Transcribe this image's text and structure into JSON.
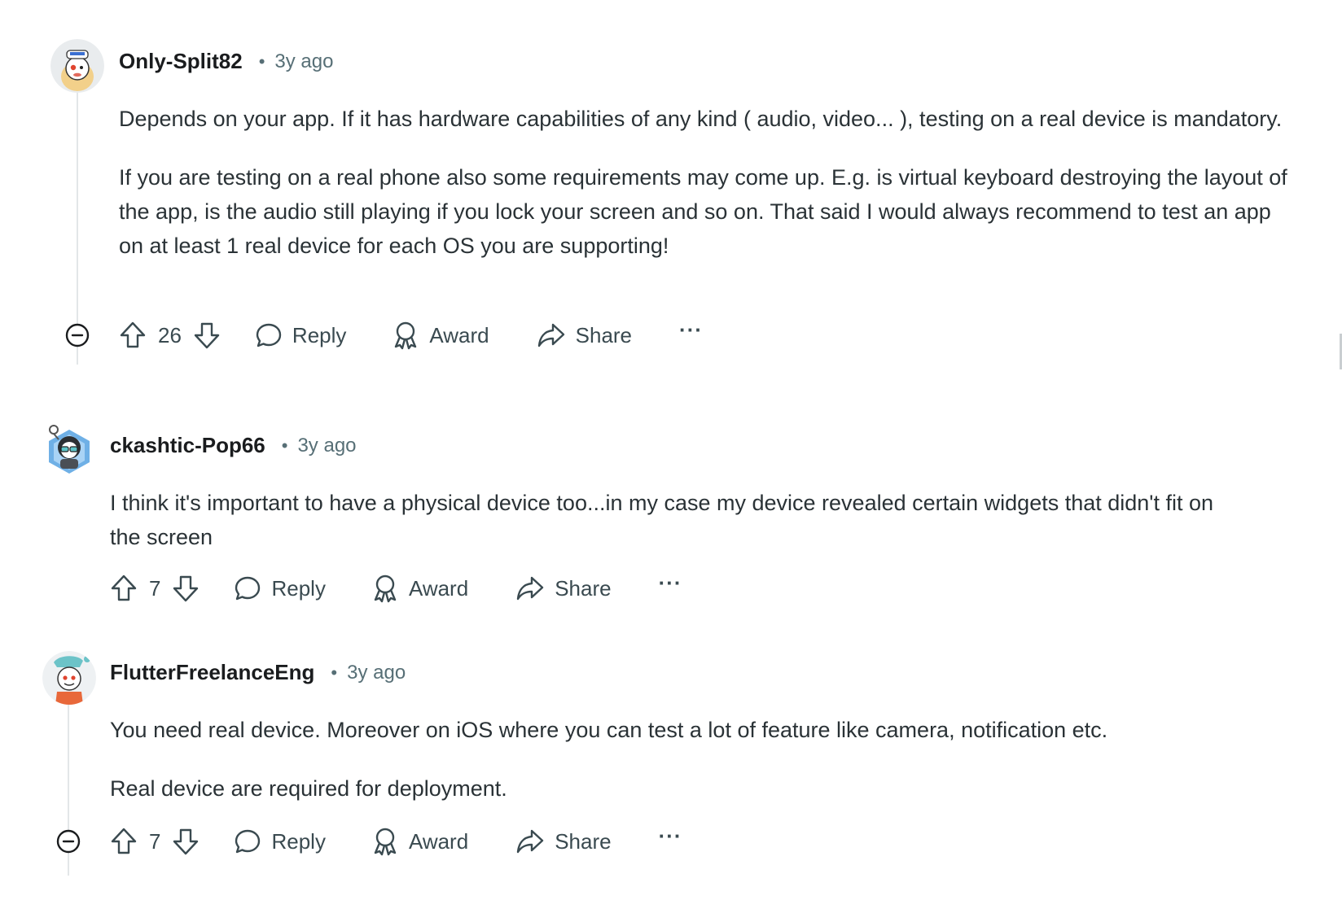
{
  "comments": [
    {
      "username": "Only-Split82",
      "time": "3y ago",
      "paragraphs": [
        "Depends on your app. If it has hardware capabilities of any kind ( audio, video... ), testing on a real device is mandatory.",
        "If you are testing on a real phone also some requirements may come up. E.g. is virtual keyboard destroying the layout of the app, is the audio still playing if you lock your screen and so on. That said I would always recommend to test an app on at least 1 real device for each OS you are supporting!"
      ],
      "votes": "26",
      "reply_label": "Reply",
      "award_label": "Award",
      "share_label": "Share",
      "more_label": "···"
    },
    {
      "username": "ckashtic-Pop66",
      "time": "3y ago",
      "paragraphs": [
        "I think it's important to have a physical device too...in my case my device revealed certain widgets that didn't fit on the screen"
      ],
      "votes": "7",
      "reply_label": "Reply",
      "award_label": "Award",
      "share_label": "Share",
      "more_label": "···"
    },
    {
      "username": "FlutterFreelanceEng",
      "time": "3y ago",
      "paragraphs": [
        "You need real device. Moreover on iOS where you can test a lot of feature like camera, notification etc.",
        "Real device are required for deployment."
      ],
      "votes": "7",
      "reply_label": "Reply",
      "award_label": "Award",
      "share_label": "Share",
      "more_label": "···"
    }
  ],
  "separator": "•",
  "icons": {
    "collapse": "collapse-minus-icon",
    "upvote": "upvote-arrow-icon",
    "downvote": "downvote-arrow-icon",
    "reply": "reply-bubble-icon",
    "award": "award-ribbon-icon",
    "share": "share-arrow-icon"
  },
  "colors": {
    "text": "#1a1c1e",
    "muted": "#576f76",
    "thread_line": "#e3e6e8"
  }
}
